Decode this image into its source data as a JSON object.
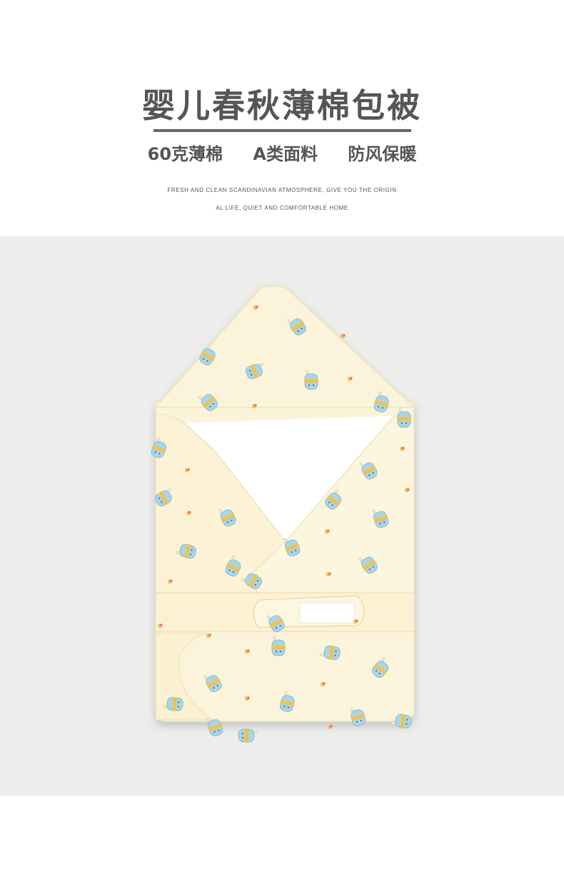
{
  "header": {
    "title": "婴儿春秋薄棉包被",
    "features": [
      "60克薄棉",
      "A类面料",
      "防风保暖"
    ],
    "tagline_line1": "FRESH AND CLEAN SCANDINAVIAN ATMOSPHERE, GIVE YOU THE ORIGIN",
    "tagline_line2": "AL LIFE, QUIET AND COMFORTABLE HOME"
  },
  "colors": {
    "title_text": "#555555",
    "photo_background": "#ededeb",
    "blanket_fabric": "#fcf4da",
    "blanket_lining": "#ffffff",
    "print_bottle_blue": "#a9d5e6",
    "print_bottle_yellow": "#f2c14e"
  },
  "photo": {
    "icon": "baby-swaddle-blanket-icon"
  }
}
